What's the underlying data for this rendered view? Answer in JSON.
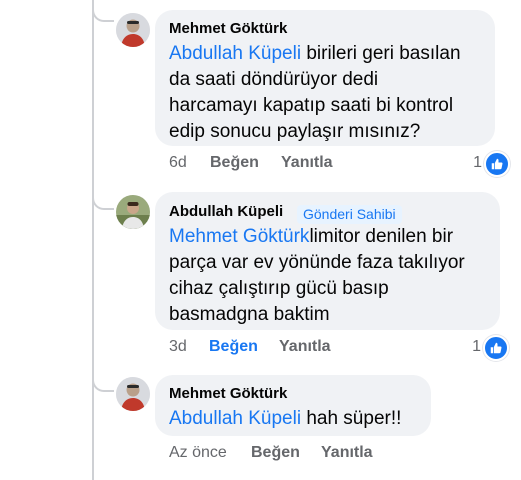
{
  "comments": [
    {
      "author": "Mehmet Göktürk",
      "mention": "Abdullah Küpeli",
      "lines": [
        "birileri geri basılan",
        "da saati döndürüyor dedi",
        "harcamayı kapatıp saati bi kontrol",
        "edip sonucu paylaşır mısınız?"
      ],
      "time": "6d",
      "like_label": "Beğen",
      "reply_label": "Yanıtla",
      "reaction_count": "1",
      "avatar_icon": "user-avatar-icon"
    },
    {
      "author": "Abdullah Küpeli",
      "author_badge": "Gönderi Sahibi",
      "mention": "Mehmet Göktürk",
      "lines": [
        "limitor denilen bir",
        "parça var ev yönünde faza takılıyor",
        "cihaz çalıştırıp gücü basıp",
        "basmadgna baktim"
      ],
      "time": "3d",
      "like_label": "Beğen",
      "reply_label": "Yanıtla",
      "reaction_count": "1",
      "avatar_icon": "user-avatar-icon"
    },
    {
      "author": "Mehmet Göktürk",
      "mention": "Abdullah Küpeli",
      "lines": [
        "hah süper!!"
      ],
      "time": "Az önce",
      "like_label": "Beğen",
      "reply_label": "Yanıtla",
      "avatar_icon": "user-avatar-icon"
    }
  ],
  "colors": {
    "link": "#1877f2",
    "bubble": "#f0f2f5",
    "meta": "#65676b",
    "thread_line": "#ced0d4",
    "badge_bg": "#e7f3ff"
  },
  "icons": {
    "reaction": "thumbs-up-icon"
  }
}
